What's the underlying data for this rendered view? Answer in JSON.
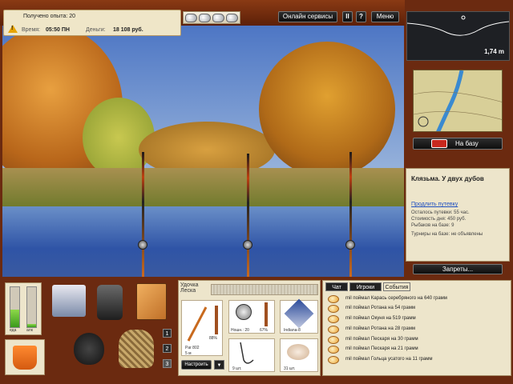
{
  "header": {
    "experience_text": "Получено опыта: 20",
    "time_label": "Время:",
    "time_value": "05:50 ПН",
    "money_label": "Деньги:",
    "money_value": "18 108 руб.",
    "warning_glyph": "!"
  },
  "topbar": {
    "online_services": "Онлайн сервисы",
    "pause": "II",
    "help": "?",
    "menu": "Меню"
  },
  "depth": {
    "value": "1,74 m"
  },
  "base_button": "На базу",
  "location": {
    "title": "Клязьма. У двух дубов",
    "extend_link": "Продлить путевку",
    "lines": [
      "Осталось путевки: 55 час.",
      "Стоимость дня: 450 руб.",
      "Рыбаков на базе: 9"
    ],
    "tournaments": "Турниры на базе: не объявлены"
  },
  "bans_button": "Запреты...",
  "meters": {
    "left_label": "еда",
    "right_label": "алк",
    "left_level": 0.45,
    "right_level": 0.08
  },
  "inventory_pages": [
    "1",
    "2",
    "3"
  ],
  "tackle": {
    "rod_label": "Удочка",
    "line_label": "Леска",
    "rod_name": "Par 802",
    "rod_length": "5 м",
    "rod_percent": "88%",
    "reel_name": "Ношн.: 20",
    "reel_percent": "67%",
    "bait_name": "Indiana-8",
    "hook_count": "9 шт.",
    "bait2_count": "31 шт.",
    "setup_button": "Настроить",
    "setup_arrow": "▼"
  },
  "chat": {
    "tabs": [
      "Чат",
      "Игроки",
      "События"
    ],
    "events": [
      "mil поймал Карась серебряного на 640 грамм",
      "mil поймал Ротана на 54 грамм",
      "mil поймал Окуня на 519 грамм",
      "mil поймал Ротана на 28 грамм",
      "mil поймал Пескаря на 30 грамм",
      "mil поймал Пескаря на 21 грамм",
      "mil поймал Гольца усатого на 11 грамм"
    ]
  },
  "icons": [
    "warning-icon",
    "fish-icon",
    "tackle-box-icon",
    "backpack-icon",
    "notebook-icon",
    "pot-icon",
    "creel-icon",
    "bucket-icon",
    "rod-icon",
    "reel-icon",
    "bait-icon",
    "hook-icon",
    "base-house-icon"
  ]
}
